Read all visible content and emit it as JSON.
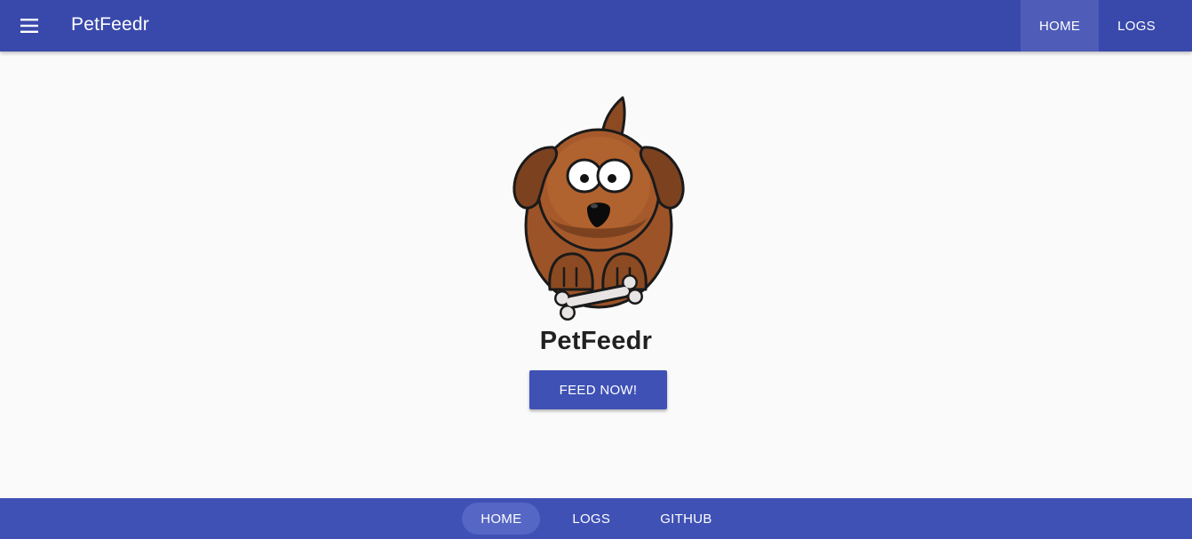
{
  "app": {
    "title": "PetFeedr",
    "menu_icon": "hamburger-menu-icon"
  },
  "top_nav": {
    "items": [
      {
        "label": "HOME",
        "active": true
      },
      {
        "label": "LOGS",
        "active": false
      }
    ]
  },
  "main": {
    "illustration": "cartoon-dog-with-bone",
    "heading": "PetFeedr",
    "feed_button_label": "FEED NOW!"
  },
  "footer": {
    "items": [
      {
        "label": "HOME",
        "active": true
      },
      {
        "label": "LOGS",
        "active": false
      },
      {
        "label": "GITHUB",
        "active": false
      }
    ]
  },
  "colors": {
    "primary": "#3f51b5",
    "toolbar": "#3949ab",
    "background": "#fafafa",
    "dog_fur": "#a0522d",
    "dog_dark": "#7a4322"
  }
}
